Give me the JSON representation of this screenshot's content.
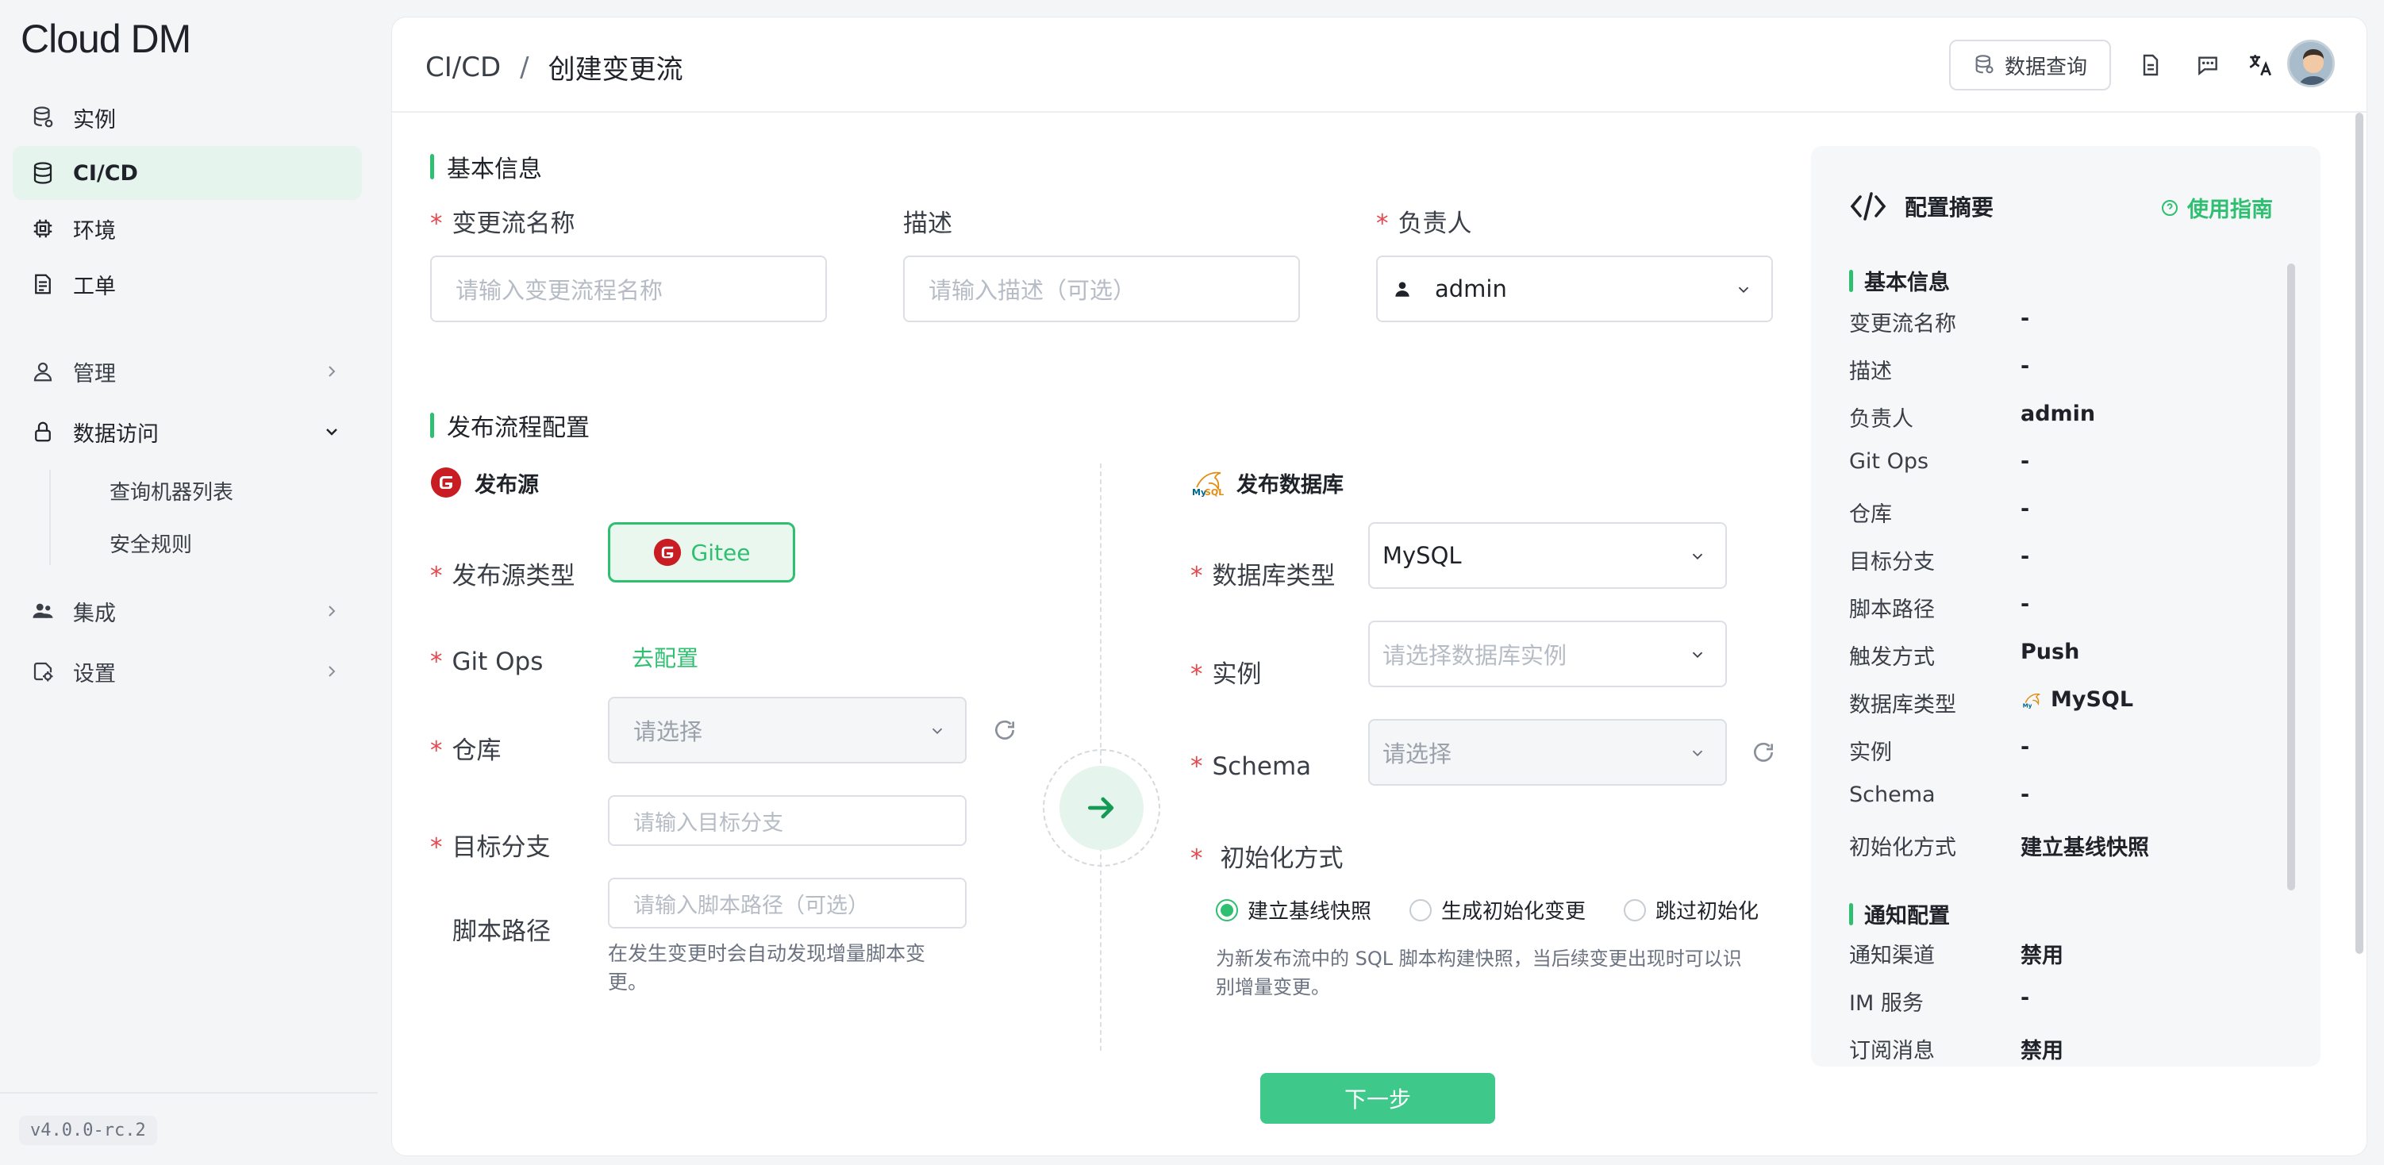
{
  "app": {
    "logo": "Cloud DM",
    "version": "v4.0.0-rc.2"
  },
  "sidebar": {
    "items": [
      {
        "label": "实例",
        "icon": "database-icon"
      },
      {
        "label": "CI/CD",
        "icon": "database-stack-icon",
        "active": true
      },
      {
        "label": "环境",
        "icon": "chip-icon"
      },
      {
        "label": "工单",
        "icon": "ticket-icon"
      },
      {
        "label": "管理",
        "icon": "user-admin-icon"
      },
      {
        "label": "数据访问",
        "icon": "lock-icon",
        "expanded": true
      },
      {
        "label": "集成",
        "icon": "users-icon"
      },
      {
        "label": "设置",
        "icon": "settings-icon"
      }
    ],
    "sub_items": [
      "查询机器列表",
      "安全规则"
    ]
  },
  "header": {
    "breadcrumb_root": "CI/CD",
    "breadcrumb_sep": "/",
    "breadcrumb_current": "创建变更流",
    "query_button": "数据查询"
  },
  "basic": {
    "title": "基本信息",
    "name_label": "变更流名称",
    "name_placeholder": "请输入变更流程名称",
    "desc_label": "描述",
    "desc_placeholder": "请输入描述（可选）",
    "owner_label": "负责人",
    "owner_value": "admin"
  },
  "publish": {
    "title": "发布流程配置",
    "source_title": "发布源",
    "source_type_label": "发布源类型",
    "source_type_value": "Gitee",
    "gitops_label": "Git Ops",
    "gitops_link": "去配置",
    "repo_label": "仓库",
    "repo_placeholder": "请选择",
    "branch_label": "目标分支",
    "branch_placeholder": "请输入目标分支",
    "script_label": "脚本路径",
    "script_placeholder": "请输入脚本路径（可选）",
    "script_hint_1": "在发生变更时会自动发现增量脚本变",
    "script_hint_2": "更。",
    "db_title": "发布数据库",
    "db_type_label": "数据库类型",
    "db_type_value": "MySQL",
    "instance_label": "实例",
    "instance_placeholder": "请选择数据库实例",
    "schema_label": "Schema",
    "schema_placeholder": "请选择",
    "init_label": "初始化方式",
    "init_options": [
      "建立基线快照",
      "生成初始化变更",
      "跳过初始化"
    ],
    "init_hint_1": "为新发布流中的 SQL 脚本构建快照，当后续变更出现时可以识",
    "init_hint_2": "别增量变更。"
  },
  "footer": {
    "next_button": "下一步"
  },
  "summary": {
    "title": "配置摘要",
    "guide": "使用指南",
    "basic_title": "基本信息",
    "rows": [
      {
        "k": "变更流名称",
        "v": "-"
      },
      {
        "k": "描述",
        "v": "-"
      },
      {
        "k": "负责人",
        "v": "admin"
      },
      {
        "k": "Git Ops",
        "v": "-"
      },
      {
        "k": "仓库",
        "v": "-"
      },
      {
        "k": "目标分支",
        "v": "-"
      },
      {
        "k": "脚本路径",
        "v": "-"
      },
      {
        "k": "触发方式",
        "v": "Push"
      },
      {
        "k": "数据库类型",
        "v": "MySQL"
      },
      {
        "k": "实例",
        "v": "-"
      },
      {
        "k": "Schema",
        "v": "-"
      },
      {
        "k": "初始化方式",
        "v": "建立基线快照"
      }
    ],
    "notify_title": "通知配置",
    "notify_rows": [
      {
        "k": "通知渠道",
        "v": "禁用"
      },
      {
        "k": "IM 服务",
        "v": "-"
      },
      {
        "k": "订阅消息",
        "v": "禁用"
      }
    ]
  },
  "colors": {
    "accent": "#2fbf71",
    "accent_bg": "#e5f4ec",
    "required": "#e5484d",
    "gitee": "#c71d23"
  }
}
